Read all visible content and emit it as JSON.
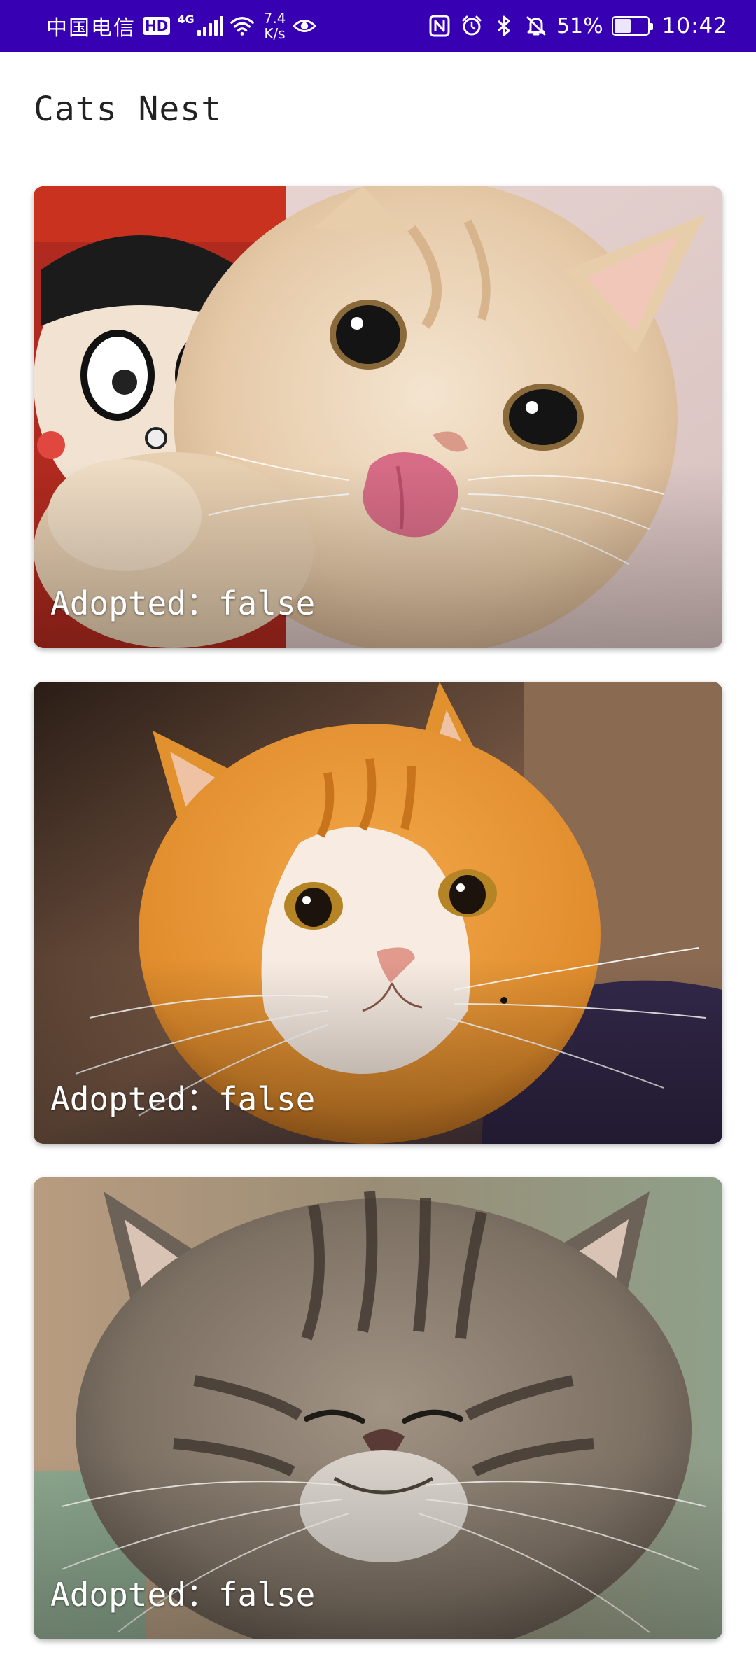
{
  "status_bar": {
    "carrier": "中国电信",
    "hd_badge": "HD",
    "network_type": "4G",
    "speed_value": "7.4",
    "speed_unit": "K/s",
    "battery_percent": "51%",
    "battery_level": 0.51,
    "time": "10:42",
    "icons": [
      "hd-icon",
      "signal-icon",
      "wifi-icon",
      "eye-icon",
      "nfc-icon",
      "alarm-icon",
      "bluetooth-icon",
      "mute-icon",
      "battery-icon"
    ],
    "background_color": "#3700B3"
  },
  "app": {
    "title": "Cats Nest"
  },
  "cats": [
    {
      "image": "cream-cat-licking-photo",
      "adopted_label": "Adopted：false"
    },
    {
      "image": "orange-white-cat-photo",
      "adopted_label": "Adopted：false"
    },
    {
      "image": "tabby-exotic-cat-photo",
      "adopted_label": "Adopted：false"
    }
  ]
}
